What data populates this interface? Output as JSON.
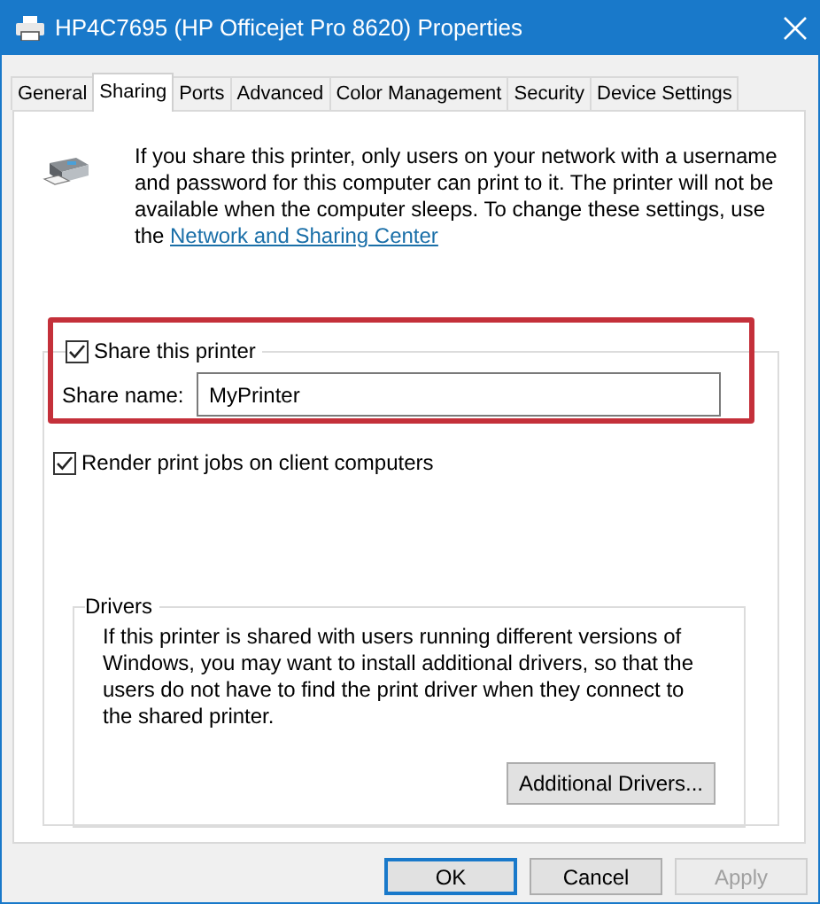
{
  "window": {
    "title": "HP4C7695 (HP Officejet Pro 8620) Properties"
  },
  "tabs": [
    {
      "label": "General",
      "selected": false
    },
    {
      "label": "Sharing",
      "selected": true
    },
    {
      "label": "Ports",
      "selected": false
    },
    {
      "label": "Advanced",
      "selected": false
    },
    {
      "label": "Color Management",
      "selected": false
    },
    {
      "label": "Security",
      "selected": false
    },
    {
      "label": "Device Settings",
      "selected": false
    }
  ],
  "intro": {
    "text": "If you share this printer, only users on your network with a username and password for this computer can print to it. The printer will not be available when the computer sleeps. To change these settings, use the",
    "link": "Network and Sharing Center"
  },
  "share": {
    "label": "Share this printer",
    "checked": true,
    "name_label": "Share name:",
    "name_value": "MyPrinter",
    "highlighted": true
  },
  "render": {
    "label": "Render print jobs on client computers",
    "checked": true
  },
  "drivers": {
    "title": "Drivers",
    "text": "If this printer is shared with users running different versions of Windows, you may want to install additional drivers, so that the users do not have to find the print driver when they connect to the shared printer.",
    "button": "Additional Drivers..."
  },
  "buttons": [
    {
      "label": "OK",
      "default": true,
      "disabled": false
    },
    {
      "label": "Cancel",
      "default": false,
      "disabled": false
    },
    {
      "label": "Apply",
      "default": false,
      "disabled": true
    }
  ]
}
